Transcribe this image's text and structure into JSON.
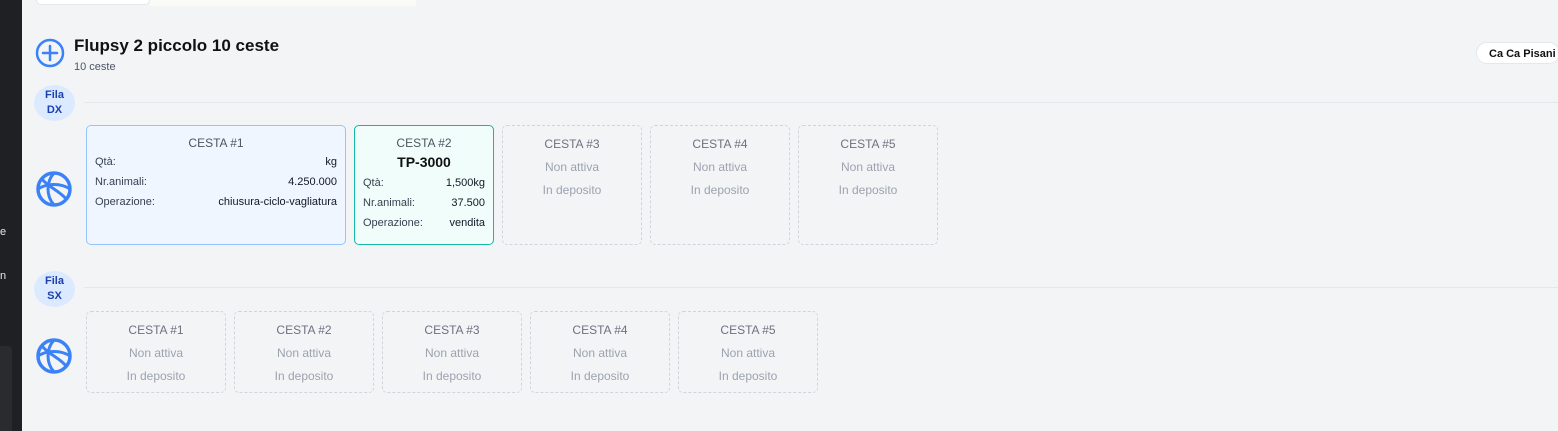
{
  "sidebar": {
    "fragment_1": "e",
    "fragment_2": "n"
  },
  "header": {
    "title": "Flupsy 2 piccolo 10 ceste",
    "subtitle": "10 ceste",
    "location": "Ca Ca Pisani",
    "add_icon": "plus-circle-icon"
  },
  "rows": [
    {
      "badge_line1": "Fila",
      "badge_line2": "DX",
      "icon": "globe-icon",
      "baskets": [
        {
          "title": "CESTA #1",
          "fields": [
            {
              "label": "Qtà:",
              "value": "kg"
            },
            {
              "label": "Nr.animali:",
              "value": "4.250.000"
            },
            {
              "label": "Operazione:",
              "value": "chiusura-ciclo-vagliatura"
            }
          ]
        },
        {
          "title": "CESTA #2",
          "code": "TP-3000",
          "fields": [
            {
              "label": "Qtà:",
              "value": "1,500kg"
            },
            {
              "label": "Nr.animali:",
              "value": "37.500"
            },
            {
              "label": "Operazione:",
              "value": "vendita"
            }
          ]
        },
        {
          "title": "CESTA #3",
          "status": "Non attiva",
          "location": "In deposito"
        },
        {
          "title": "CESTA #4",
          "status": "Non attiva",
          "location": "In deposito"
        },
        {
          "title": "CESTA #5",
          "status": "Non attiva",
          "location": "In deposito"
        }
      ]
    },
    {
      "badge_line1": "Fila",
      "badge_line2": "SX",
      "icon": "globe-icon",
      "baskets": [
        {
          "title": "CESTA #1",
          "status": "Non attiva",
          "location": "In deposito"
        },
        {
          "title": "CESTA #2",
          "status": "Non attiva",
          "location": "In deposito"
        },
        {
          "title": "CESTA #3",
          "status": "Non attiva",
          "location": "In deposito"
        },
        {
          "title": "CESTA #4",
          "status": "Non attiva",
          "location": "In deposito"
        },
        {
          "title": "CESTA #5",
          "status": "Non attiva",
          "location": "In deposito"
        }
      ]
    }
  ],
  "colors": {
    "accent_blue": "#3b82f6",
    "active_border_blue": "#93c5fd",
    "active_border_teal": "#14b8a6"
  }
}
